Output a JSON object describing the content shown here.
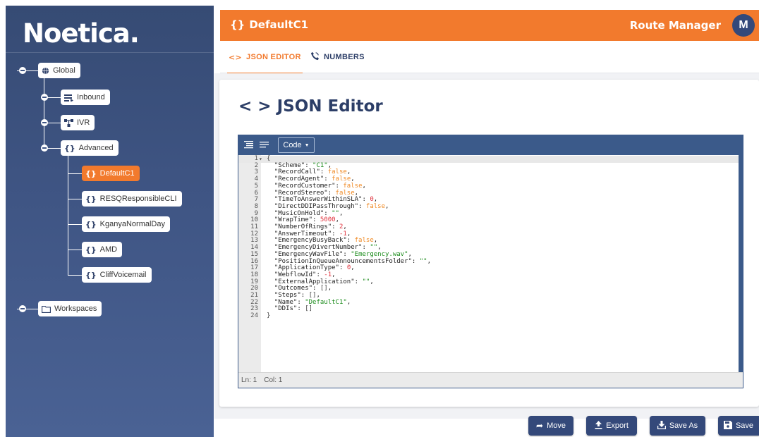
{
  "sidebar": {
    "logo": "Noetica.",
    "tree": {
      "global": {
        "label": "Global",
        "icon": "globe-icon"
      },
      "inbound": {
        "label": "Inbound",
        "icon": "list-icon"
      },
      "ivr": {
        "label": "IVR",
        "icon": "flow-icon"
      },
      "advanced": {
        "label": "Advanced",
        "icon": "braces-icon"
      },
      "items": [
        {
          "label": "DefaultC1",
          "icon": "braces-icon",
          "active": true
        },
        {
          "label": "RESQResponsibleCLI",
          "icon": "braces-icon"
        },
        {
          "label": "KganyaNormalDay",
          "icon": "braces-icon"
        },
        {
          "label": "AMD",
          "icon": "braces-icon"
        },
        {
          "label": "CliffVoicemail",
          "icon": "braces-icon"
        }
      ],
      "workspaces": {
        "label": "Workspaces",
        "icon": "folder-icon"
      }
    }
  },
  "header": {
    "title": "DefaultC1",
    "title_icon": "braces-icon",
    "app_name": "Route Manager",
    "avatar_initial": "M"
  },
  "tabs": [
    {
      "label": "JSON EDITOR",
      "icon": "code-icon",
      "active": true
    },
    {
      "label": "NUMBERS",
      "icon": "phone-icon",
      "active": false
    }
  ],
  "card": {
    "title": "JSON Editor",
    "title_icon": "code-icon"
  },
  "editor": {
    "mode_label": "Code",
    "status": {
      "ln": "Ln: 1",
      "col": "Col: 1"
    },
    "lines": [
      {
        "n": "1",
        "t": "{",
        "c": "p"
      },
      {
        "n": "2",
        "k": "\"Scheme\"",
        "v": "\"C1\"",
        "c": "s"
      },
      {
        "n": "3",
        "k": "\"RecordCall\"",
        "v": "false",
        "c": "b"
      },
      {
        "n": "4",
        "k": "\"RecordAgent\"",
        "v": "false",
        "c": "b"
      },
      {
        "n": "5",
        "k": "\"RecordCustomer\"",
        "v": "false",
        "c": "b"
      },
      {
        "n": "6",
        "k": "\"RecordStereo\"",
        "v": "false",
        "c": "b"
      },
      {
        "n": "7",
        "k": "\"TimeToAnswerWithinSLA\"",
        "v": "0",
        "c": "n"
      },
      {
        "n": "8",
        "k": "\"DirectDDIPassThrough\"",
        "v": "false",
        "c": "b"
      },
      {
        "n": "9",
        "k": "\"MusicOnHold\"",
        "v": "\"\"",
        "c": "s"
      },
      {
        "n": "10",
        "k": "\"WrapTime\"",
        "v": "5000",
        "c": "n"
      },
      {
        "n": "11",
        "k": "\"NumberOfRings\"",
        "v": "2",
        "c": "n"
      },
      {
        "n": "12",
        "k": "\"AnswerTimeout\"",
        "v": "-1",
        "c": "n"
      },
      {
        "n": "13",
        "k": "\"EmergencyBusyBack\"",
        "v": "false",
        "c": "b"
      },
      {
        "n": "14",
        "k": "\"EmergencyDivertNumber\"",
        "v": "\"\"",
        "c": "s"
      },
      {
        "n": "15",
        "k": "\"EmergencyWavFile\"",
        "v": "\"Emergency.wav\"",
        "c": "s"
      },
      {
        "n": "16",
        "k": "\"PositionInQueueAnnouncementsFolder\"",
        "v": "\"\"",
        "c": "s"
      },
      {
        "n": "17",
        "k": "\"ApplicationType\"",
        "v": "0",
        "c": "n"
      },
      {
        "n": "18",
        "k": "\"WebflowId\"",
        "v": "-1",
        "c": "n"
      },
      {
        "n": "19",
        "k": "\"ExternalApplication\"",
        "v": "\"\"",
        "c": "s"
      },
      {
        "n": "20",
        "k": "\"Outcomes\"",
        "v": "[]",
        "c": "p"
      },
      {
        "n": "21",
        "k": "\"Steps\"",
        "v": "[]",
        "c": "p"
      },
      {
        "n": "22",
        "k": "\"Name\"",
        "v": "\"DefaultC1\"",
        "c": "s"
      },
      {
        "n": "23",
        "k": "\"DDIs\"",
        "v": "[]",
        "c": "p",
        "last": true
      },
      {
        "n": "24",
        "t": "}",
        "c": "p"
      }
    ]
  },
  "actions": [
    {
      "label": "Move",
      "icon": "move-icon"
    },
    {
      "label": "Export",
      "icon": "upload-icon"
    },
    {
      "label": "Save As",
      "icon": "download-icon"
    },
    {
      "label": "Save",
      "icon": "floppy-icon"
    }
  ],
  "colors": {
    "accent": "#f27a2d",
    "navy": "#34497a",
    "sidebar": "#3f5584",
    "json_string": "#1a8b1a",
    "json_boolean": "#f08a24",
    "json_number": "#e0303b"
  }
}
